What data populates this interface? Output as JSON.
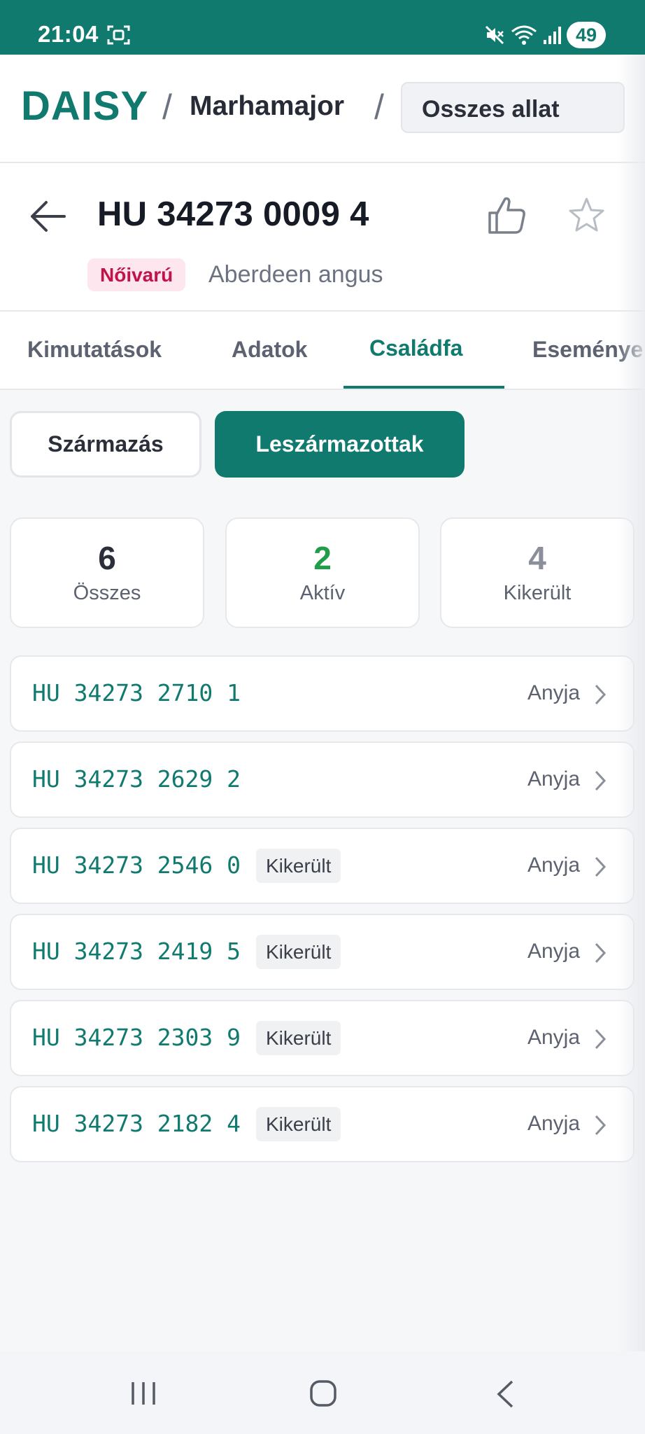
{
  "status_bar": {
    "time": "21:04",
    "battery": "49",
    "icons": [
      "screen-record-icon",
      "mute-icon",
      "wifi-icon",
      "signal-icon",
      "battery-icon"
    ]
  },
  "header": {
    "logo": "DAISY",
    "separator": "/",
    "farm": "Marhamajor",
    "animal_filter": "Osszes allat"
  },
  "animal": {
    "id": "HU 34273 0009 4",
    "sex": "Nőivarú",
    "breed": "Aberdeen angus"
  },
  "tabs": [
    {
      "label": "Kimutatások",
      "active": false
    },
    {
      "label": "Adatok",
      "active": false
    },
    {
      "label": "Családfa",
      "active": true
    },
    {
      "label": "Eseménye",
      "active": false
    }
  ],
  "subtabs": {
    "origin": "Származás",
    "descendants": "Leszármazottak",
    "active": "descendants"
  },
  "stats": [
    {
      "value": "6",
      "label": "Összes",
      "color": "#2a2f3a"
    },
    {
      "value": "2",
      "label": "Aktív",
      "color": "#1f9d48"
    },
    {
      "value": "4",
      "label": "Kikerült",
      "color": "#8a8f99"
    }
  ],
  "descendants": [
    {
      "id": "HU 34273 2710 1",
      "status": "",
      "relation": "Anyja"
    },
    {
      "id": "HU 34273 2629 2",
      "status": "",
      "relation": "Anyja"
    },
    {
      "id": "HU 34273 2546 0",
      "status": "Kikerült",
      "relation": "Anyja"
    },
    {
      "id": "HU 34273 2419 5",
      "status": "Kikerült",
      "relation": "Anyja"
    },
    {
      "id": "HU 34273 2303 9",
      "status": "Kikerült",
      "relation": "Anyja"
    },
    {
      "id": "HU 34273 2182 4",
      "status": "Kikerült",
      "relation": "Anyja"
    }
  ],
  "colors": {
    "brand": "#117a6f",
    "sex_badge_bg": "#fde6ee",
    "sex_badge_text": "#c0134b",
    "active_green": "#1f9d48"
  }
}
